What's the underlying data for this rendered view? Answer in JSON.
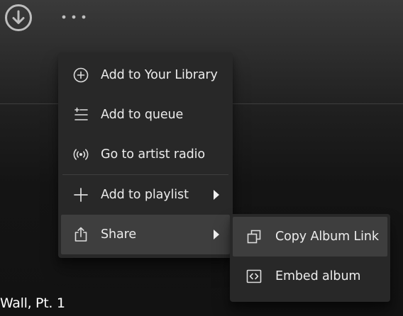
{
  "track": {
    "title": "Wall, Pt. 1"
  },
  "toolbar": {
    "download_icon": "download-icon",
    "more_icon": "more-icon"
  },
  "context_menu": {
    "items": [
      {
        "label": "Add to Your Library",
        "icon": "plus-circle-icon"
      },
      {
        "label": "Add to queue",
        "icon": "queue-add-icon"
      },
      {
        "label": "Go to artist radio",
        "icon": "radio-icon"
      },
      {
        "label": "Add to playlist",
        "icon": "plus-icon",
        "has_submenu": true
      },
      {
        "label": "Share",
        "icon": "share-icon",
        "has_submenu": true,
        "active": true
      }
    ]
  },
  "share_submenu": {
    "items": [
      {
        "label": "Copy Album Link",
        "icon": "copy-icon",
        "active": true
      },
      {
        "label": "Embed album",
        "icon": "embed-icon"
      }
    ]
  },
  "colors": {
    "menu_bg": "#282828",
    "hover_bg": "#3e3e3e",
    "text": "#ececec"
  }
}
